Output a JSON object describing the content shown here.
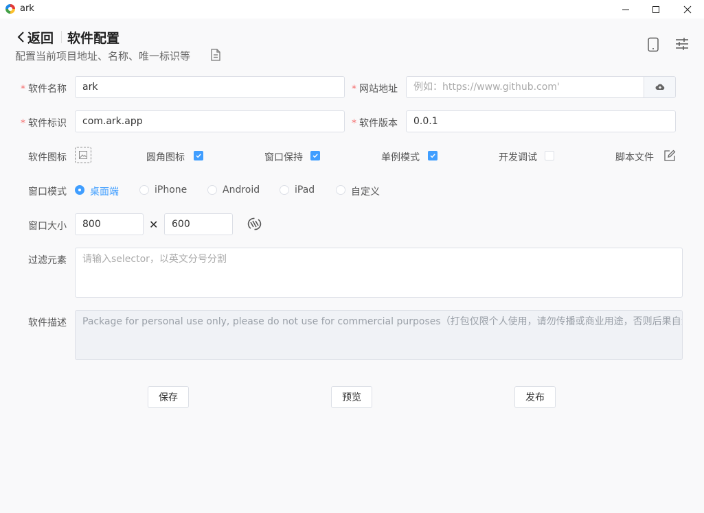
{
  "window": {
    "app_title": "ark",
    "controls": {
      "minimize": "minimize",
      "maximize": "maximize",
      "close": "close"
    }
  },
  "header": {
    "back_label": "返回",
    "title": "软件配置",
    "subtitle": "配置当前项目地址、名称、唯一标识等"
  },
  "form": {
    "app_name": {
      "label": "软件名称",
      "required": "*",
      "value": "ark"
    },
    "website": {
      "label": "网站地址",
      "required": "*",
      "placeholder": "例如：https://www.github.com'"
    },
    "app_id": {
      "label": "软件标识",
      "required": "*",
      "value": "com.ark.app"
    },
    "version": {
      "label": "软件版本",
      "required": "*",
      "value": "0.0.1"
    },
    "options": {
      "icon_label": "软件图标",
      "round_icon": {
        "label": "圆角图标",
        "checked": true
      },
      "keep_window": {
        "label": "窗口保持",
        "checked": true
      },
      "single_instance": {
        "label": "单例模式",
        "checked": true
      },
      "dev_debug": {
        "label": "开发调试",
        "checked": false
      },
      "script_file": {
        "label": "脚本文件"
      }
    },
    "window_mode": {
      "label": "窗口模式",
      "selected": "桌面端",
      "options": [
        "桌面端",
        "iPhone",
        "Android",
        "iPad",
        "自定义"
      ]
    },
    "window_size": {
      "label": "窗口大小",
      "width": "800",
      "height": "600",
      "separator": "✕"
    },
    "filter": {
      "label": "过滤元素",
      "placeholder": "请输入selector，以英文分号分割"
    },
    "description": {
      "label": "软件描述",
      "value": "Package for personal use only, please do not use for commercial purposes（打包仅限个人使用，请勿传播或商业用途，否则后果自负）"
    }
  },
  "actions": {
    "save": "保存",
    "preview": "预览",
    "publish": "发布"
  },
  "colors": {
    "accent": "#409eff",
    "required": "#f56c6c",
    "border": "#dcdfe6"
  }
}
